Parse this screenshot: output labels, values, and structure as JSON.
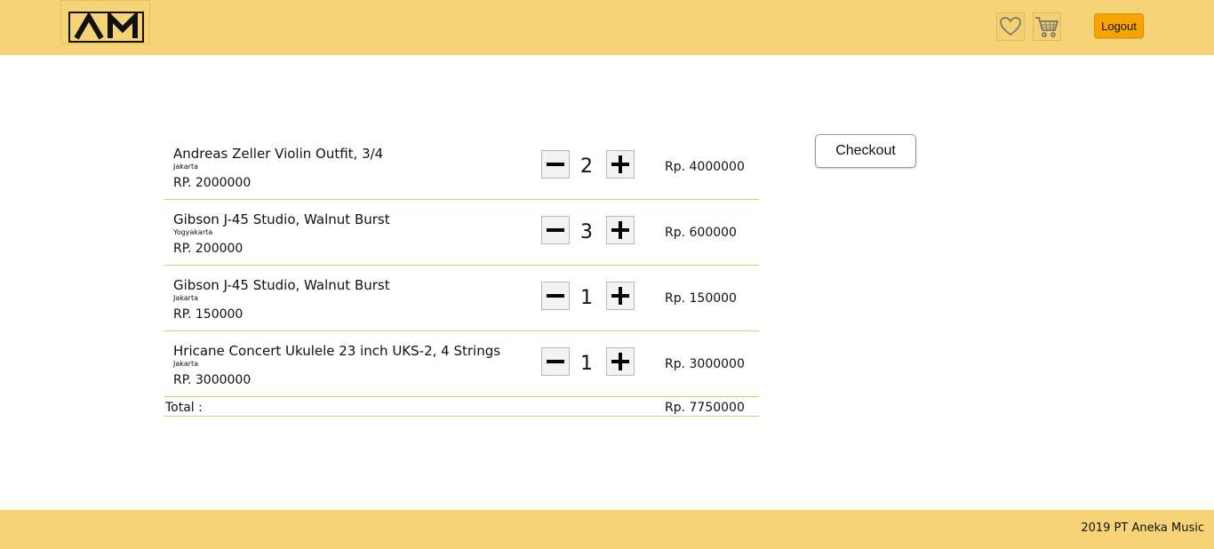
{
  "header": {
    "logo_text": "AM",
    "logout_label": "Logout"
  },
  "cart": {
    "items": [
      {
        "name": "Andreas Zeller Violin Outfit, 3/4",
        "city": "Jakarta",
        "price": "RP. 2000000",
        "quantity": "2",
        "subtotal": "Rp. 4000000"
      },
      {
        "name": "Gibson J-45 Studio, Walnut Burst",
        "city": "Yogyakarta",
        "price": "RP. 200000",
        "quantity": "3",
        "subtotal": "Rp. 600000"
      },
      {
        "name": "Gibson J-45 Studio, Walnut Burst",
        "city": "Jakarta",
        "price": "RP. 150000",
        "quantity": "1",
        "subtotal": "Rp. 150000"
      },
      {
        "name": "Hricane Concert Ukulele 23 inch UKS-2, 4 Strings",
        "city": "Jakarta",
        "price": "RP. 3000000",
        "quantity": "1",
        "subtotal": "Rp. 3000000"
      }
    ],
    "total_label": "Total :",
    "total_value": "Rp. 7750000"
  },
  "checkout_label": "Checkout",
  "footer": {
    "text": "2019 PT Aneka Music"
  },
  "icons": {
    "logo": "am-logo-icon",
    "wishlist": "heart-icon",
    "cart": "shopping-cart-icon",
    "minus": "minus-icon",
    "plus": "plus-icon"
  },
  "colors": {
    "header_bg": "#f5d376",
    "logout_bg": "#f8a400",
    "divider": "#e7c66d"
  }
}
